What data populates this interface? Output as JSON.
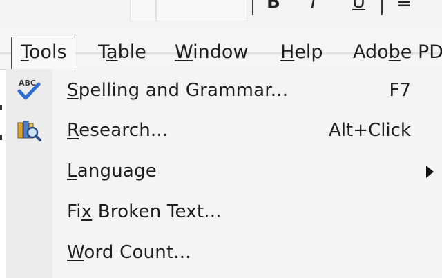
{
  "toolbar": {
    "glyph_bold": "B",
    "glyph_italic": "I",
    "glyph_underline": "U",
    "glyph_align": "≡"
  },
  "menubar": {
    "items": [
      {
        "pre": "",
        "mnemonic": "T",
        "post": "ools"
      },
      {
        "pre": "T",
        "mnemonic": "a",
        "post": "ble"
      },
      {
        "pre": "",
        "mnemonic": "W",
        "post": "indow"
      },
      {
        "pre": "",
        "mnemonic": "H",
        "post": "elp"
      },
      {
        "pre": "Ado",
        "mnemonic": "b",
        "post": "e PDF"
      }
    ]
  },
  "tools_menu": {
    "items": [
      {
        "pre": "",
        "mnemonic": "S",
        "post": "pelling and Grammar...",
        "shortcut": "F7",
        "icon": "spelling-abc-check-icon"
      },
      {
        "pre": "",
        "mnemonic": "R",
        "post": "esearch...",
        "shortcut": "Alt+Click",
        "icon": "research-books-icon"
      },
      {
        "pre": "",
        "mnemonic": "L",
        "post": "anguage",
        "shortcut": "",
        "submenu": true
      },
      {
        "pre": "Fi",
        "mnemonic": "x",
        "post": " Broken Text...",
        "shortcut": ""
      },
      {
        "pre": "",
        "mnemonic": "W",
        "post": "ord Count...",
        "shortcut": ""
      }
    ]
  }
}
